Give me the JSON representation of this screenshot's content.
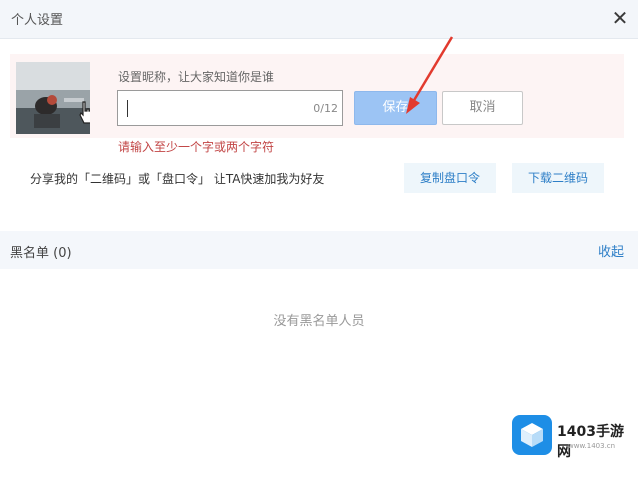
{
  "dialog": {
    "title": "个人设置",
    "close_icon": "close-icon"
  },
  "profile": {
    "avatar_icon": "avatar-photo",
    "cursor_icon": "hand-pointer-icon",
    "nickname_label": "设置昵称，让大家知道你是谁",
    "nickname_value": "",
    "nickname_counter": "0/12",
    "save_label": "保存",
    "cancel_label": "取消",
    "error_message": "请输入至少一个字或两个字符"
  },
  "share": {
    "text": "分享我的「二维码」或「盘口令」 让TA快速加我为好友",
    "copy_label": "复制盘口令",
    "download_label": "下载二维码"
  },
  "blacklist": {
    "title": "黑名单 (0)",
    "collapse_label": "收起",
    "empty_message": "没有黑名单人员"
  },
  "watermark": {
    "brand": "1403手游网",
    "url": "www.1403.cn"
  },
  "colors": {
    "accent": "#2e7fc7",
    "save_disabled": "#9cc4f4",
    "error": "#c24545",
    "annotation_arrow": "#e23a2e"
  }
}
